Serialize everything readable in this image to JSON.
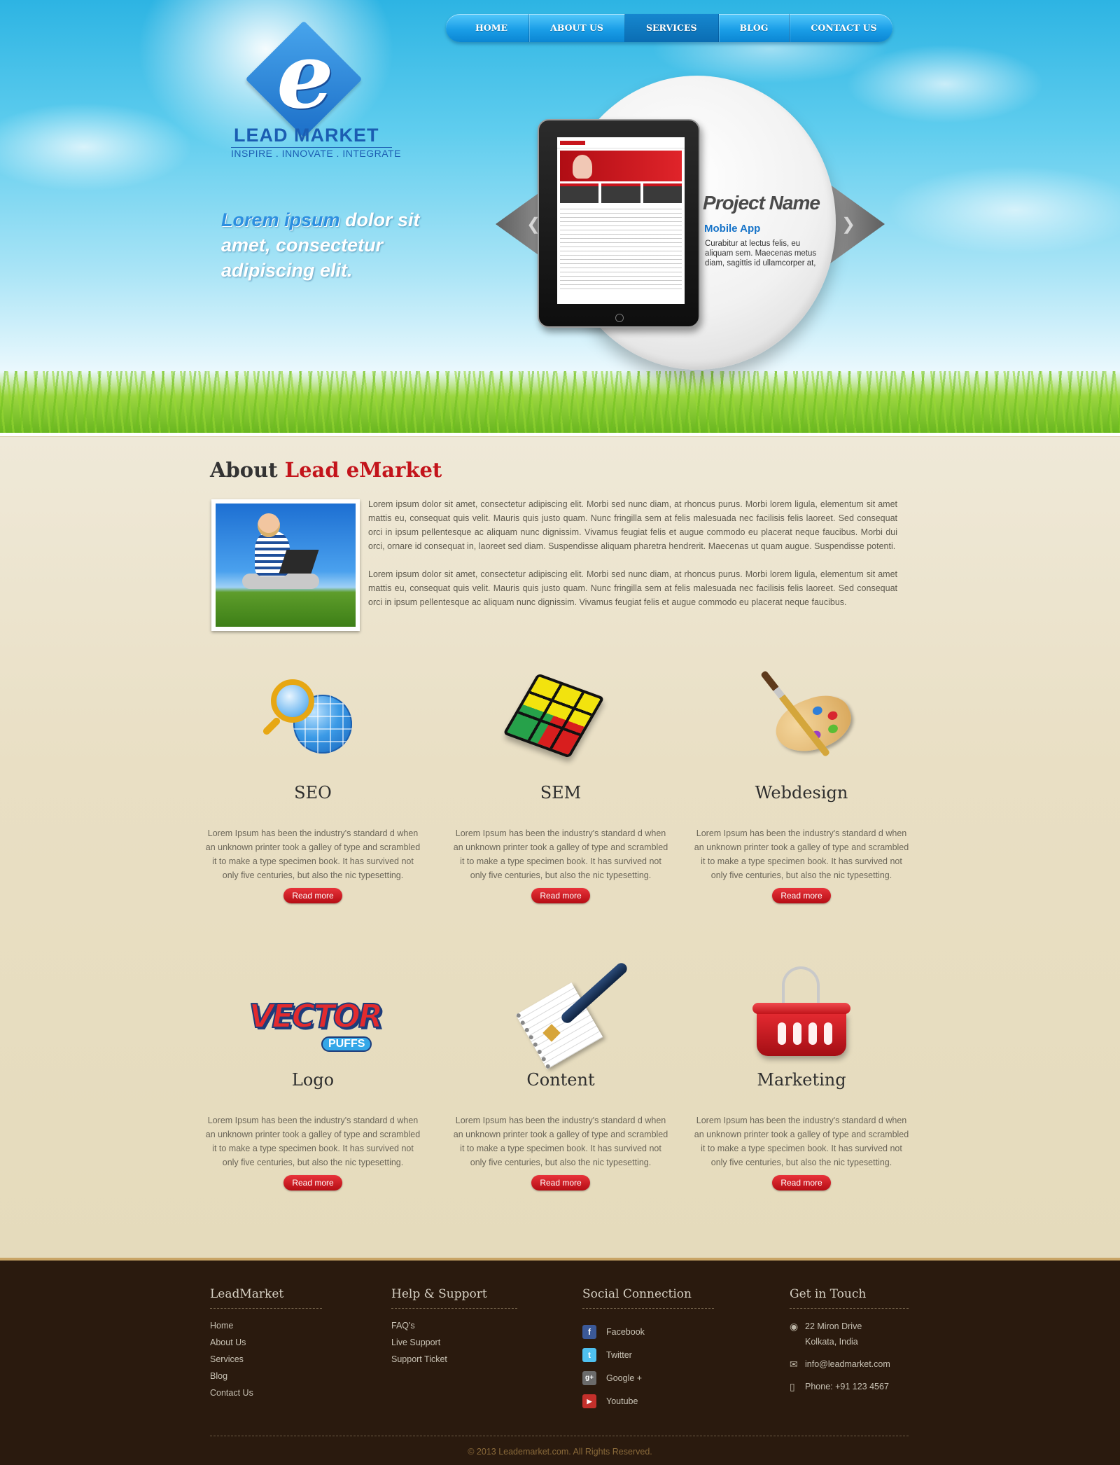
{
  "nav": {
    "items": [
      {
        "label": "HOME"
      },
      {
        "label": "ABOUT US"
      },
      {
        "label": "SERVICES"
      },
      {
        "label": "BLOG"
      },
      {
        "label": "CONTACT US"
      }
    ],
    "active": "SERVICES"
  },
  "logo": {
    "letter": "e",
    "name": "LEAD MARKET",
    "tagline": "INSPIRE . INNOVATE . INTEGRATE"
  },
  "hero": {
    "highlight": "Lorem ipsum",
    "text": " dolor sit amet, consectetur adipiscing elit."
  },
  "slider": {
    "title": "Project Name",
    "subtitle": "Mobile App",
    "description": "Curabitur at lectus felis, eu aliquam sem. Maecenas metus diam, sagittis id ullamcorper at,",
    "prev_icon": "chevron-left-icon",
    "next_icon": "chevron-right-icon"
  },
  "about": {
    "title_prefix": "About",
    "title_brand": "Lead eMarket",
    "paragraphs": [
      "Lorem ipsum dolor sit amet, consectetur adipiscing elit. Morbi sed nunc diam, at rhoncus purus. Morbi lorem ligula, elementum sit amet mattis eu, consequat quis velit. Mauris quis justo quam. Nunc fringilla sem at felis malesuada nec facilisis felis laoreet. Sed consequat orci in ipsum pellentesque ac aliquam nunc dignissim. Vivamus feugiat felis et augue commodo eu placerat neque faucibus. Morbi dui orci, ornare id consequat in, laoreet sed diam. Suspendisse aliquam pharetra hendrerit. Maecenas ut quam augue. Suspendisse potenti.",
      "Lorem ipsum dolor sit amet, consectetur adipiscing elit. Morbi sed nunc diam, at rhoncus purus. Morbi lorem ligula, elementum sit amet mattis eu, consequat quis velit. Mauris quis justo quam. Nunc fringilla sem at felis malesuada nec facilisis felis laoreet. Sed consequat orci in ipsum pellentesque ac aliquam nunc dignissim. Vivamus feugiat felis et augue commodo eu placerat neque faucibus."
    ]
  },
  "services": [
    {
      "title": "SEO",
      "icon": "seo-globe-icon",
      "description": "Lorem Ipsum has been the industry's standard d when an unknown printer took a galley of type and scrambled it to make a type specimen book. It has survived not only five centuries, but also the nic typesetting.",
      "button": "Read more"
    },
    {
      "title": "SEM",
      "icon": "rubiks-cube-icon",
      "description": "Lorem Ipsum has been the industry's standard d when an unknown printer took a galley of type and scrambled it to make a type specimen book. It has survived not only five centuries, but also the nic typesetting.",
      "button": "Read more"
    },
    {
      "title": "Webdesign",
      "icon": "paint-palette-icon",
      "description": "Lorem Ipsum has been the industry's standard d when an unknown printer took a galley of type and scrambled it to make a type specimen book. It has survived not only five centuries, but also the nic typesetting.",
      "button": "Read more"
    },
    {
      "title": "Logo",
      "icon": "vector-puffs-logo-icon",
      "logo_word": "VECTOR",
      "logo_sub": "PUFFS",
      "description": "Lorem Ipsum has been the industry's standard d when an unknown printer took a galley of type and scrambled it to make a type specimen book. It has survived not only five centuries, but also the nic typesetting.",
      "button": "Read more"
    },
    {
      "title": "Content",
      "icon": "notebook-pen-icon",
      "description": "Lorem Ipsum has been the industry's standard d when an unknown printer took a galley of type and scrambled it to make a type specimen book. It has survived not only five centuries, but also the nic typesetting.",
      "button": "Read more"
    },
    {
      "title": "Marketing",
      "icon": "shopping-basket-icon",
      "description": "Lorem Ipsum has been the industry's standard d when an unknown printer took a galley of type and scrambled it to make a type specimen book. It has survived not only five centuries, but also the nic typesetting.",
      "button": "Read more"
    }
  ],
  "footer": {
    "col1": {
      "heading": "LeadMarket",
      "links": [
        "Home",
        "About Us",
        "Services",
        "Blog",
        "Contact Us"
      ]
    },
    "col2": {
      "heading": "Help & Support",
      "links": [
        "FAQ's",
        "Live Support",
        "Support Ticket"
      ]
    },
    "col3": {
      "heading": "Social Connection",
      "links": [
        {
          "label": "Facebook",
          "icon": "facebook-icon",
          "glyph": "f",
          "color": "#3b5998"
        },
        {
          "label": "Twitter",
          "icon": "twitter-icon",
          "glyph": "t",
          "color": "#4fc1f0"
        },
        {
          "label": "Google +",
          "icon": "google-plus-icon",
          "glyph": "g+",
          "color": "#6b6b6b"
        },
        {
          "label": "Youtube",
          "icon": "youtube-icon",
          "glyph": "▶",
          "color": "#c4302b"
        }
      ]
    },
    "col4": {
      "heading": "Get in Touch",
      "address_line1": "22 Miron Drive",
      "address_line2": "Kolkata, India",
      "email": "info@leadmarket.com",
      "phone": "Phone: +91 123 4567"
    },
    "copyright": "© 2013 Leademarket.com. All Rights Reserved."
  },
  "colors": {
    "brand_red": "#c3141b",
    "nav_blue": "#1a9ee7",
    "link_blue": "#1673c8",
    "footer_bg": "#2a1a0e"
  }
}
